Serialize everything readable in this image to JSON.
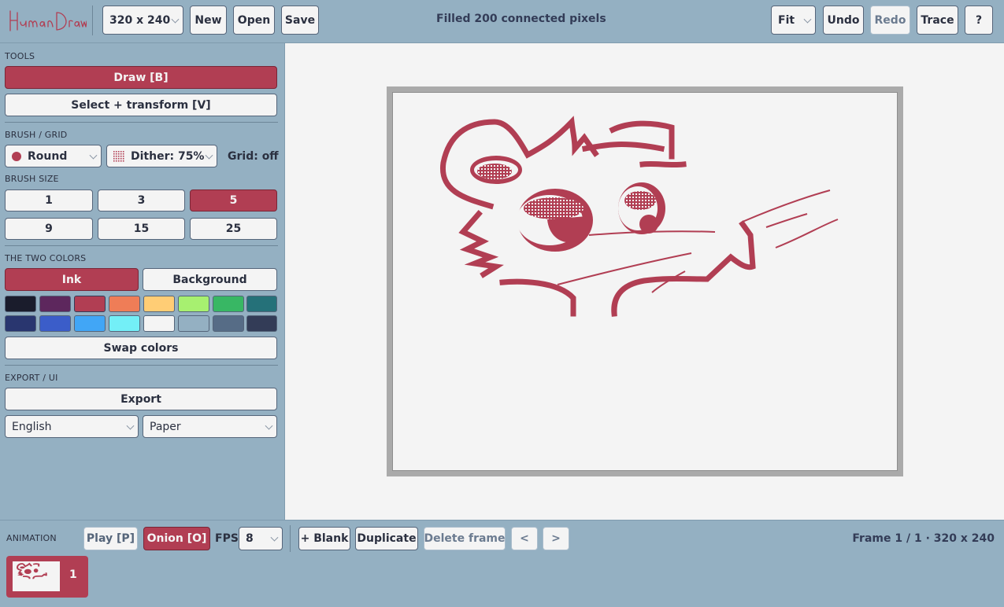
{
  "app": {
    "title": "Human Draw"
  },
  "toolbar": {
    "size_value": "320 x 240",
    "new_label": "New",
    "open_label": "Open",
    "save_label": "Save",
    "status": "Filled 200 connected pixels",
    "zoom_value": "Fit",
    "undo_label": "Undo",
    "redo_label": "Redo",
    "trace_label": "Trace",
    "help_label": "?"
  },
  "tools": {
    "heading": "TOOLS",
    "draw_label": "Draw  [B]",
    "select_label": "Select + transform  [V]"
  },
  "brush_grid": {
    "heading": "BRUSH / GRID",
    "shape_value": "Round",
    "dither_value": "Dither: 75%",
    "grid_label": "Grid: off"
  },
  "brush_size": {
    "heading": "BRUSH SIZE",
    "sizes": [
      "1",
      "3",
      "5",
      "9",
      "15",
      "25"
    ],
    "selected": "5"
  },
  "colors": {
    "heading": "THE TWO COLORS",
    "ink_label": "Ink",
    "background_label": "Background",
    "palette": [
      "#1a1c2c",
      "#5d275d",
      "#b13e53",
      "#ef7d57",
      "#ffcd75",
      "#a7f070",
      "#38b764",
      "#257179",
      "#29366f",
      "#3b5dc9",
      "#41a6f6",
      "#73eff7",
      "#f4f4f4",
      "#94b0c2",
      "#566c86",
      "#333c57"
    ],
    "swap_label": "Swap colors",
    "ink_color": "#b13e53"
  },
  "export_ui": {
    "heading": "EXPORT / UI",
    "export_label": "Export",
    "language_value": "English",
    "theme_value": "Paper"
  },
  "animation": {
    "heading": "ANIMATION",
    "play_label": "Play  [P]",
    "onion_label": "Onion  [O]",
    "fps_label": "FPS",
    "fps_value": "8",
    "blank_label": "+ Blank",
    "duplicate_label": "Duplicate",
    "delete_label": "Delete frame",
    "prev_label": "<",
    "next_label": ">",
    "frame_info": "Frame 1 / 1  ·  320 x 240",
    "frames": [
      {
        "number": "1"
      }
    ]
  },
  "theme": {
    "accent": "#b13e53",
    "panel": "#94b0c2",
    "paper": "#f4f4f4",
    "text": "#2b3040"
  }
}
